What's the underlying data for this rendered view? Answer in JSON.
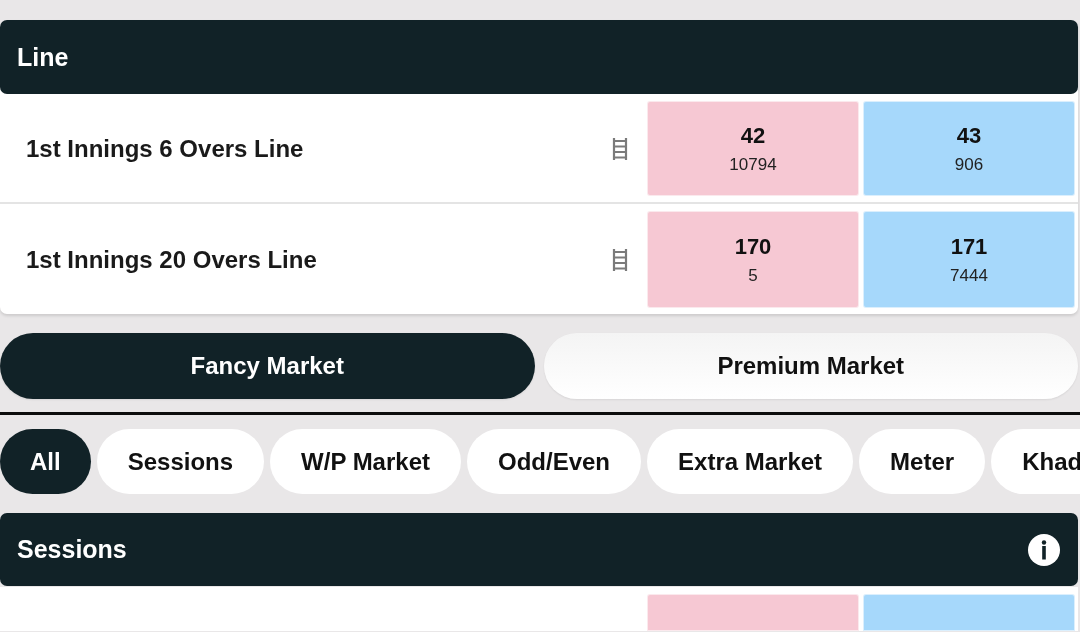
{
  "line_section": {
    "title": "Line",
    "rows": [
      {
        "name": "1st Innings 6 Overs Line",
        "prices": [
          {
            "kind": "back",
            "odds": "42",
            "size": "10794"
          },
          {
            "kind": "lay",
            "odds": "43",
            "size": "906"
          }
        ]
      },
      {
        "name": "1st Innings 20 Overs Line",
        "prices": [
          {
            "kind": "back",
            "odds": "170",
            "size": "5"
          },
          {
            "kind": "lay",
            "odds": "171",
            "size": "7444"
          }
        ]
      }
    ]
  },
  "market_tabs": [
    {
      "label": "Fancy Market",
      "selected": true
    },
    {
      "label": "Premium Market",
      "selected": false
    }
  ],
  "category_chips": [
    {
      "label": "All",
      "selected": true
    },
    {
      "label": "Sessions",
      "selected": false
    },
    {
      "label": "W/P Market",
      "selected": false
    },
    {
      "label": "Odd/Even",
      "selected": false
    },
    {
      "label": "Extra Market",
      "selected": false
    },
    {
      "label": "Meter",
      "selected": false
    },
    {
      "label": "Khad",
      "selected": false
    }
  ],
  "sessions_section": {
    "title": "Sessions",
    "row_prices": [
      {
        "kind": "back"
      },
      {
        "kind": "lay"
      }
    ]
  }
}
